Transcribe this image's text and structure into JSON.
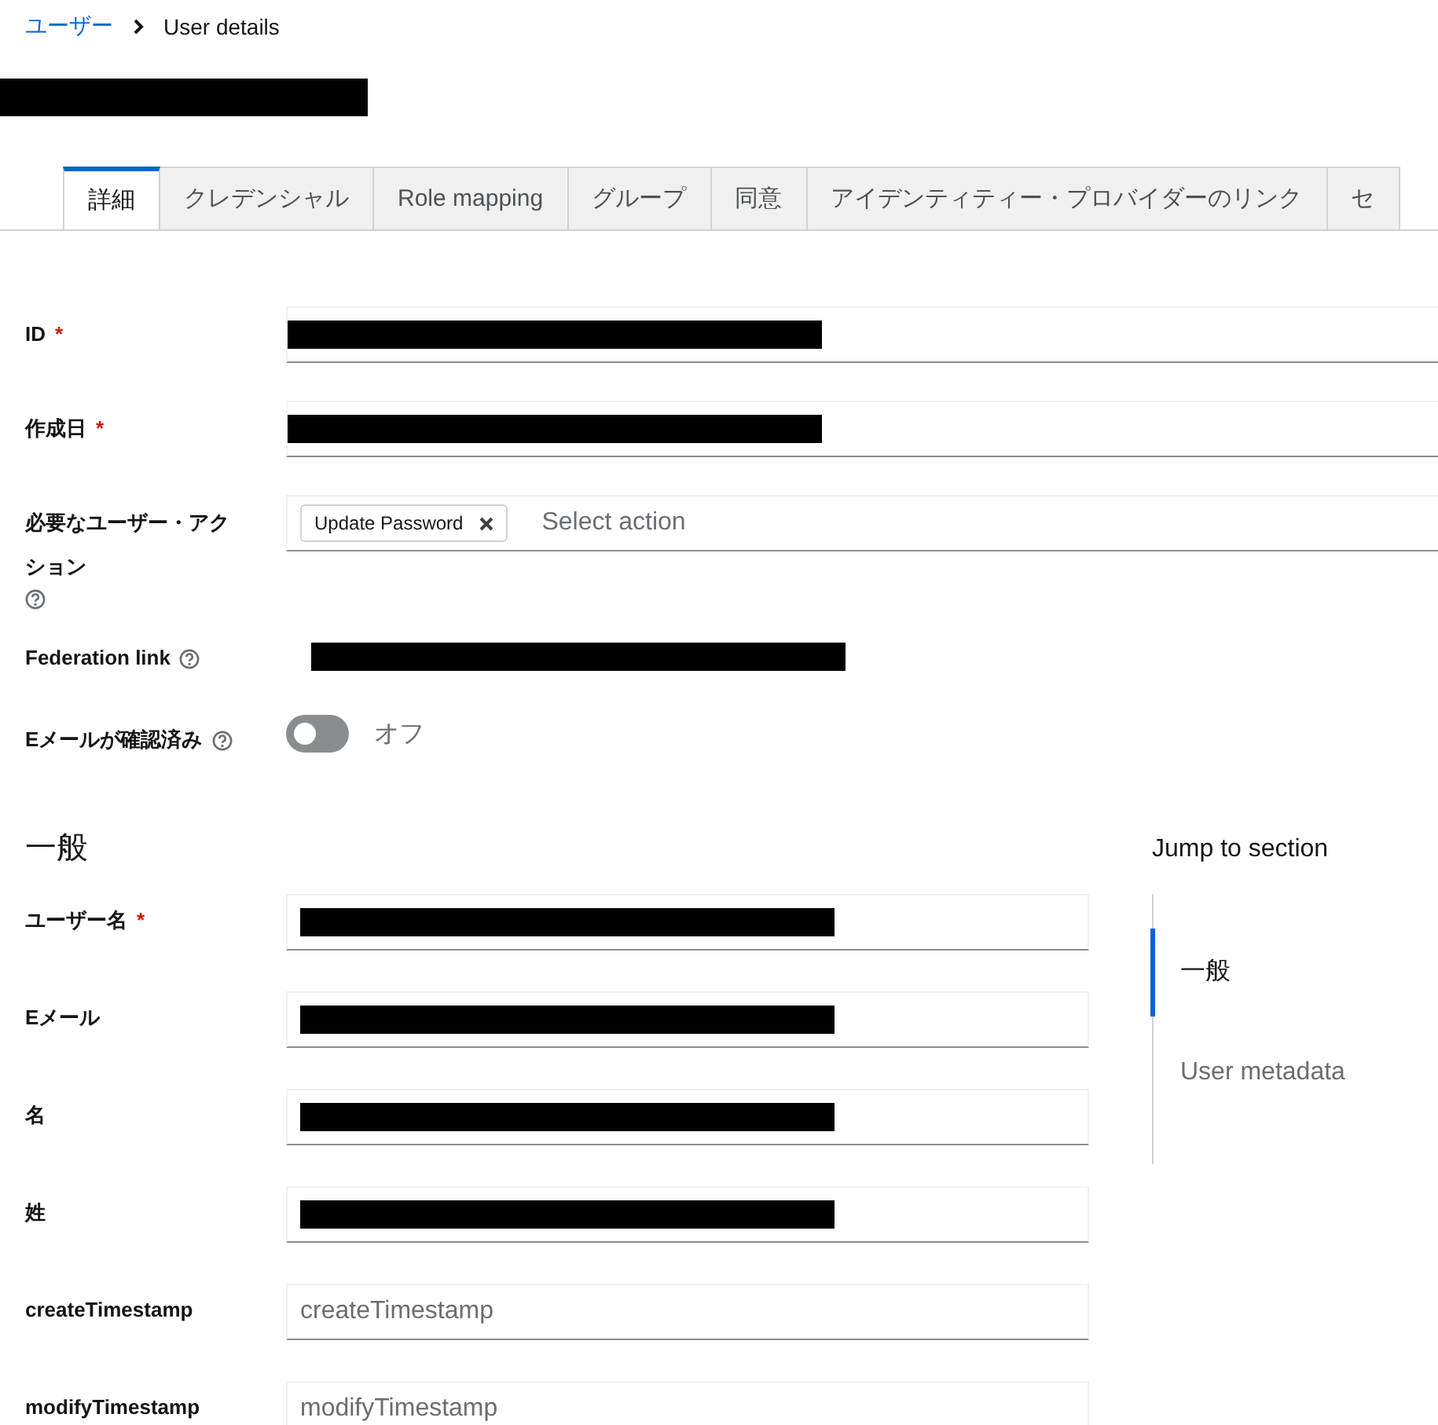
{
  "breadcrumb": [
    {
      "label": "ユーザー",
      "link": true
    },
    {
      "label": "User details",
      "link": false
    }
  ],
  "title": {
    "redacted": true
  },
  "tabs": [
    {
      "label": "詳細",
      "selected": true
    },
    {
      "label": "クレデンシャル",
      "selected": false
    },
    {
      "label": "Role mapping",
      "selected": false
    },
    {
      "label": "グループ",
      "selected": false
    },
    {
      "label": "同意",
      "selected": false
    },
    {
      "label": "アイデンティティー・プロバイダーのリンク",
      "selected": false
    },
    {
      "label": "セ",
      "selected": false
    }
  ],
  "top_fields": [
    {
      "kind": "input",
      "label": "ID",
      "required_mark": "*",
      "redacted": true
    },
    {
      "kind": "input",
      "label": "作成日",
      "required_mark": "*",
      "redacted": true
    },
    {
      "kind": "chips",
      "label": "必要なユーザー・アクション",
      "help": true,
      "chips": [
        "Update Password"
      ],
      "placeholder": "Select action"
    },
    {
      "kind": "link",
      "label": "Federation link",
      "help": true,
      "redacted": true
    },
    {
      "kind": "switch",
      "label": "Eメールが確認済み",
      "help": true,
      "on": false,
      "state_label": "オフ"
    }
  ],
  "section": {
    "title": "一般",
    "fields": [
      {
        "label": "ユーザー名",
        "required_mark": "*",
        "redacted": true
      },
      {
        "label": "Eメール",
        "redacted": true
      },
      {
        "label": "名",
        "redacted": true
      },
      {
        "label": "姓",
        "redacted": true
      },
      {
        "label": "createTimestamp",
        "placeholder": "createTimestamp"
      },
      {
        "label": "modifyTimestamp",
        "placeholder": "modifyTimestamp"
      }
    ]
  },
  "jump": {
    "title": "Jump to section",
    "items": [
      {
        "label": "一般",
        "selected": true
      },
      {
        "label": "User metadata",
        "selected": false
      }
    ]
  }
}
